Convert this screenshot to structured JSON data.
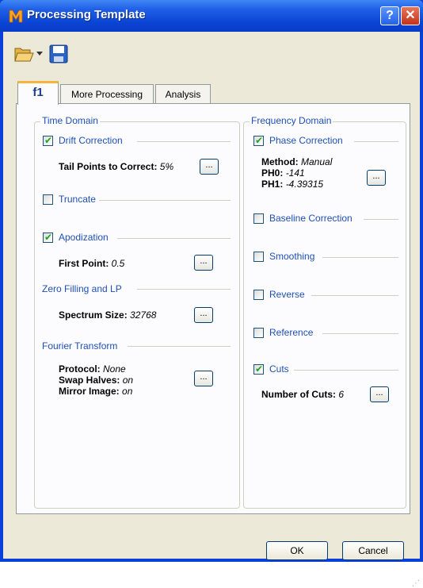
{
  "window": {
    "title": "Processing Template",
    "help_label": "?",
    "close_label": "✕"
  },
  "toolbar": {
    "icons": [
      "open-folder-icon",
      "dropdown-arrow-icon",
      "save-icon"
    ]
  },
  "tabs": [
    {
      "label": "f1",
      "active": true
    },
    {
      "label": "More Processing",
      "active": false
    },
    {
      "label": "Analysis",
      "active": false
    }
  ],
  "time_domain": {
    "title": "Time Domain",
    "drift": {
      "label": "Drift Correction",
      "checked": true,
      "prop_label": "Tail Points to Correct:",
      "prop_value": "5%",
      "button": "..."
    },
    "truncate": {
      "label": "Truncate",
      "checked": false
    },
    "apodization": {
      "label": "Apodization",
      "checked": true,
      "prop_label": "First Point:",
      "prop_value": "0.5",
      "button": "..."
    },
    "zero_filling": {
      "title": "Zero Filling and LP",
      "prop_label": "Spectrum Size:",
      "prop_value": "32768",
      "button": "..."
    },
    "fourier": {
      "title": "Fourier Transform",
      "protocol_label": "Protocol:",
      "protocol_value": "None",
      "swap_label": "Swap Halves:",
      "swap_value": "on",
      "mirror_label": "Mirror Image:",
      "mirror_value": "on",
      "button": "..."
    }
  },
  "frequency_domain": {
    "title": "Frequency Domain",
    "phase": {
      "label": "Phase Correction",
      "checked": true,
      "method_label": "Method:",
      "method_value": "Manual",
      "ph0_label": "PH0:",
      "ph0_value": "-141",
      "ph1_label": "PH1:",
      "ph1_value": "-4.39315",
      "button": "..."
    },
    "baseline": {
      "label": "Baseline Correction",
      "checked": false
    },
    "smoothing": {
      "label": "Smoothing",
      "checked": false
    },
    "reverse": {
      "label": "Reverse",
      "checked": false
    },
    "reference": {
      "label": "Reference",
      "checked": false
    },
    "cuts": {
      "label": "Cuts",
      "checked": true,
      "prop_label": "Number of Cuts:",
      "prop_value": "6",
      "button": "..."
    }
  },
  "footer": {
    "ok_label": "OK",
    "cancel_label": "Cancel"
  },
  "check_mark": "✔"
}
